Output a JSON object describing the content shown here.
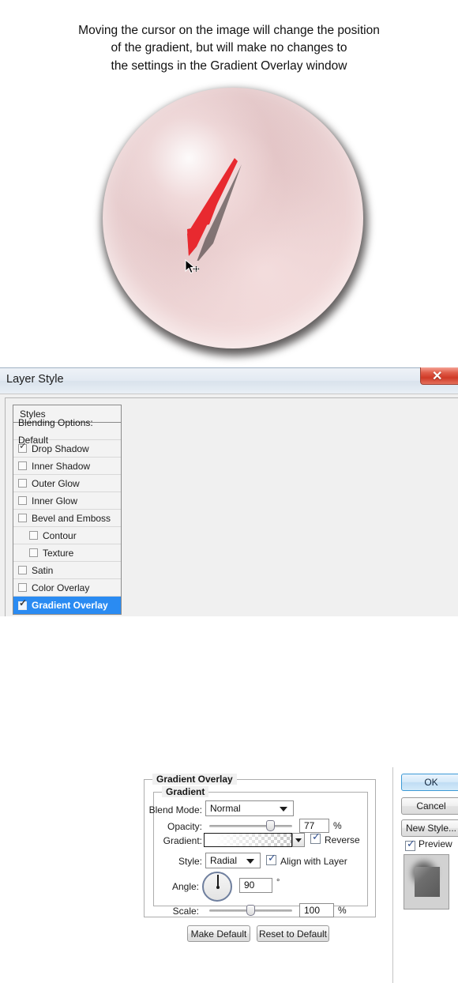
{
  "caption": {
    "line1": "Moving the cursor on the image will change the position",
    "line2": "of the gradient, but will make no changes to",
    "line3": "the settings in the Gradient Overlay window"
  },
  "artwork": {
    "name": "pink-sphere",
    "sphere_color": "#e3c7c8",
    "highlight_color": "#ffffff",
    "shadow_color": "#2a2626",
    "arrow_color": "#e8292f",
    "cursor": "move-cursor"
  },
  "dialog": {
    "title": "Layer Style",
    "close_label": "✕"
  },
  "styles_panel": {
    "header": "Styles",
    "blending_options": "Blending Options: Default",
    "items": [
      {
        "label": "Drop Shadow",
        "checked": true,
        "indent": false,
        "selected": false
      },
      {
        "label": "Inner Shadow",
        "checked": false,
        "indent": false,
        "selected": false
      },
      {
        "label": "Outer Glow",
        "checked": false,
        "indent": false,
        "selected": false
      },
      {
        "label": "Inner Glow",
        "checked": false,
        "indent": false,
        "selected": false
      },
      {
        "label": "Bevel and Emboss",
        "checked": false,
        "indent": false,
        "selected": false
      },
      {
        "label": "Contour",
        "checked": false,
        "indent": true,
        "selected": false
      },
      {
        "label": "Texture",
        "checked": false,
        "indent": true,
        "selected": false
      },
      {
        "label": "Satin",
        "checked": false,
        "indent": false,
        "selected": false
      },
      {
        "label": "Color Overlay",
        "checked": false,
        "indent": false,
        "selected": false
      },
      {
        "label": "Gradient Overlay",
        "checked": true,
        "indent": false,
        "selected": true
      }
    ],
    "selected_color": "#2a8bf2"
  },
  "gradient_overlay": {
    "group_title": "Gradient Overlay",
    "subgroup_title": "Gradient",
    "blend_mode": {
      "label": "Blend Mode:",
      "value": "Normal"
    },
    "opacity": {
      "label": "Opacity:",
      "value": "77",
      "unit": "%",
      "percent": 77
    },
    "gradient": {
      "label": "Gradient:",
      "swatch": "white-to-transparent"
    },
    "reverse": {
      "label": "Reverse",
      "checked": true
    },
    "style": {
      "label": "Style:",
      "value": "Radial"
    },
    "align_with_layer": {
      "label": "Align with Layer",
      "checked": true
    },
    "angle": {
      "label": "Angle:",
      "value": "90",
      "unit": "°",
      "degrees": 90
    },
    "scale": {
      "label": "Scale:",
      "value": "100",
      "unit": "%",
      "percent": 100
    },
    "make_default": "Make Default",
    "reset_to_default": "Reset to Default"
  },
  "buttons": {
    "ok": "OK",
    "cancel": "Cancel",
    "new_style": "New Style...",
    "preview_label": "Preview",
    "preview_checked": true
  }
}
